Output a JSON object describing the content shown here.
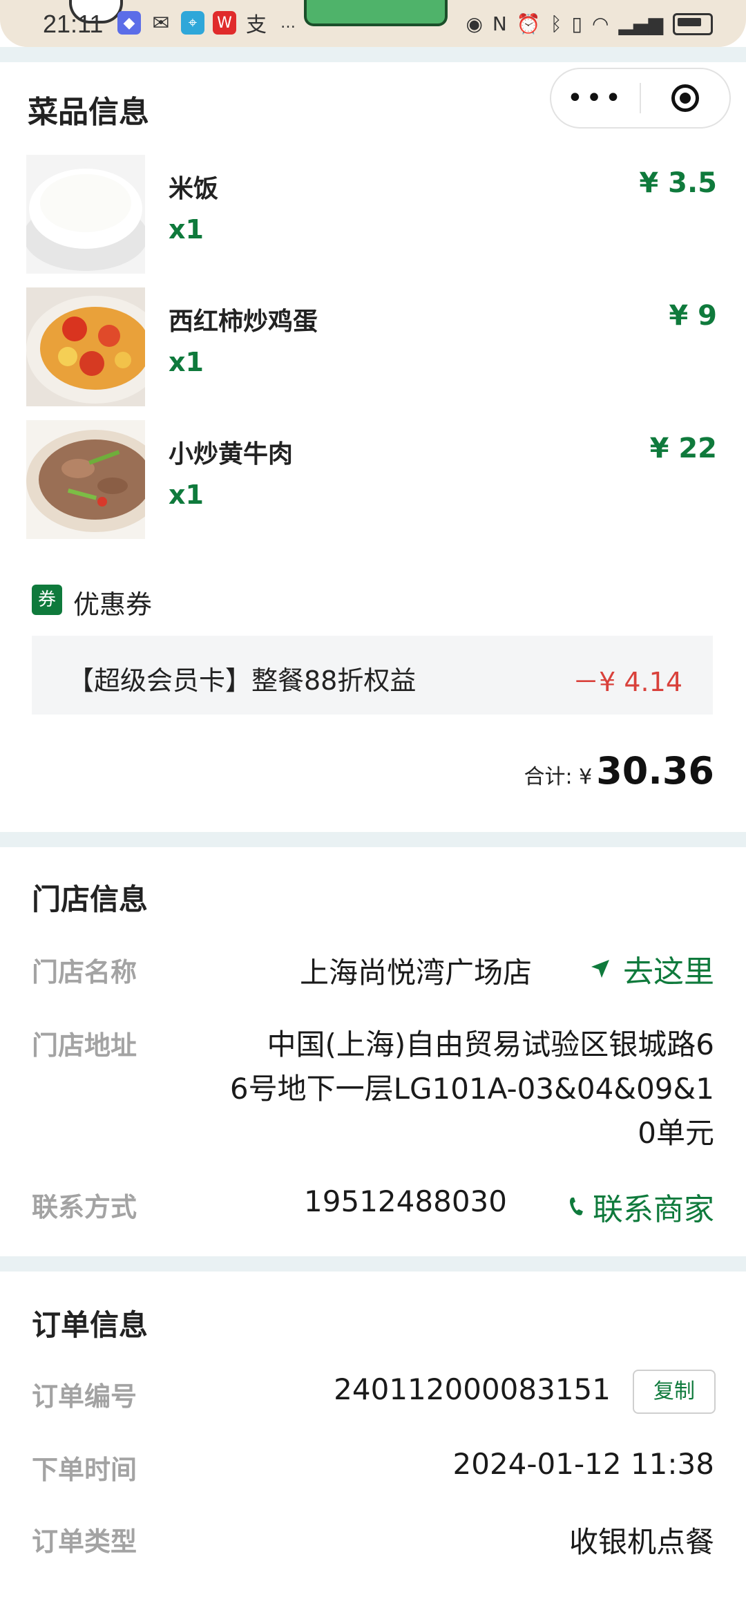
{
  "status_bar": {
    "time": "21:11"
  },
  "dishes_section": {
    "title": "菜品信息",
    "items": [
      {
        "name": "米饭",
        "qty": "x1",
        "price": "¥ 3.5"
      },
      {
        "name": "西红柿炒鸡蛋",
        "qty": "x1",
        "price": "¥ 9"
      },
      {
        "name": "小炒黄牛肉",
        "qty": "x1",
        "price": "¥ 22"
      }
    ]
  },
  "coupon": {
    "tag": "券",
    "title": "优惠券",
    "description": "【超级会员卡】整餐88折权益",
    "amount": "－¥ 4.14"
  },
  "total": {
    "label": "合计: ¥",
    "value": "30.36"
  },
  "store_section": {
    "title": "门店信息",
    "name_label": "门店名称",
    "name_value": "上海尚悦湾广场店",
    "navigate_label": "去这里",
    "address_label": "门店地址",
    "address_lines": [
      "中国(上海)自由贸易试验区银城路6",
      "6号地下一层LG101A-03&04&09&1",
      "0单元"
    ],
    "contact_label": "联系方式",
    "contact_value": "19512488030",
    "contact_link": "联系商家"
  },
  "order_section": {
    "title": "订单信息",
    "number_label": "订单编号",
    "number_value": "240112000083151",
    "copy_label": "复制",
    "time_label": "下单时间",
    "time_value": "2024-01-12 11:38",
    "type_label": "订单类型",
    "type_value": "收银机点餐"
  },
  "colors": {
    "accent_green": "#0f7a3c",
    "discount_red": "#d9413b",
    "label_gray": "#a3a3a3"
  }
}
